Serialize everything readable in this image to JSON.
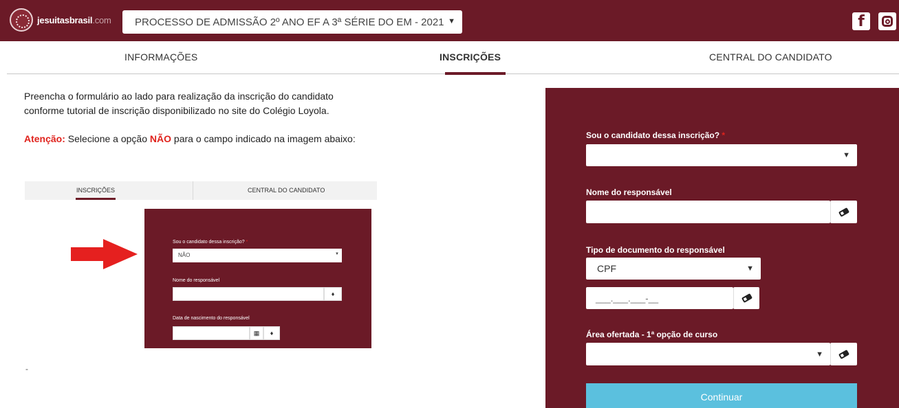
{
  "header": {
    "logo_text_bold": "jesuitasbrasil",
    "logo_text_suffix": ".com",
    "process_selected": "PROCESSO DE ADMISSÃO 2º ANO EF A 3ª SÉRIE DO EM - 2021",
    "social": [
      "facebook-icon",
      "instagram-icon"
    ]
  },
  "nav": {
    "tabs": [
      {
        "label": "INFORMAÇÕES",
        "active": false
      },
      {
        "label": "INSCRIÇÕES",
        "active": true
      },
      {
        "label": "CENTRAL DO CANDIDATO",
        "active": false
      }
    ]
  },
  "intro": {
    "line1": "Preencha o formulário ao lado para realização da inscrição do candidato",
    "line2": "conforme tutorial de inscrição disponibilizado no site do Colégio Loyola.",
    "attention_label": "Atenção:",
    "attention_text_1": " Selecione a opção ",
    "attention_option": "NÃO",
    "attention_text_2": " para o campo indicado na imagem abaixo:",
    "footer_dash": "-"
  },
  "tutorial_image": {
    "tab_inscricoes": "INSCRIÇÕES",
    "tab_central": "CENTRAL DO CANDIDATO",
    "label_candidate": "Sou o candidato dessa inscrição?",
    "required_mark": "*",
    "selected_value": "NÃO",
    "label_guardian": "Nome do responsável",
    "label_birth": "Data de nascimento do responsável"
  },
  "form": {
    "label_candidate": "Sou o candidato dessa inscrição?",
    "required_mark": "*",
    "candidate_value": "",
    "label_guardian_name": "Nome do responsável",
    "guardian_name_value": "",
    "label_doc_type": "Tipo de documento do responsável",
    "doc_type_value": "CPF",
    "doc_number_mask": "___.___.___-__",
    "label_area": "Área ofertada - 1ª opção de curso",
    "area_value": "",
    "continue_label": "Continuar"
  },
  "colors": {
    "brand": "#6b1a27",
    "accent_button": "#5bc0de",
    "alert_red": "#e0231d"
  }
}
